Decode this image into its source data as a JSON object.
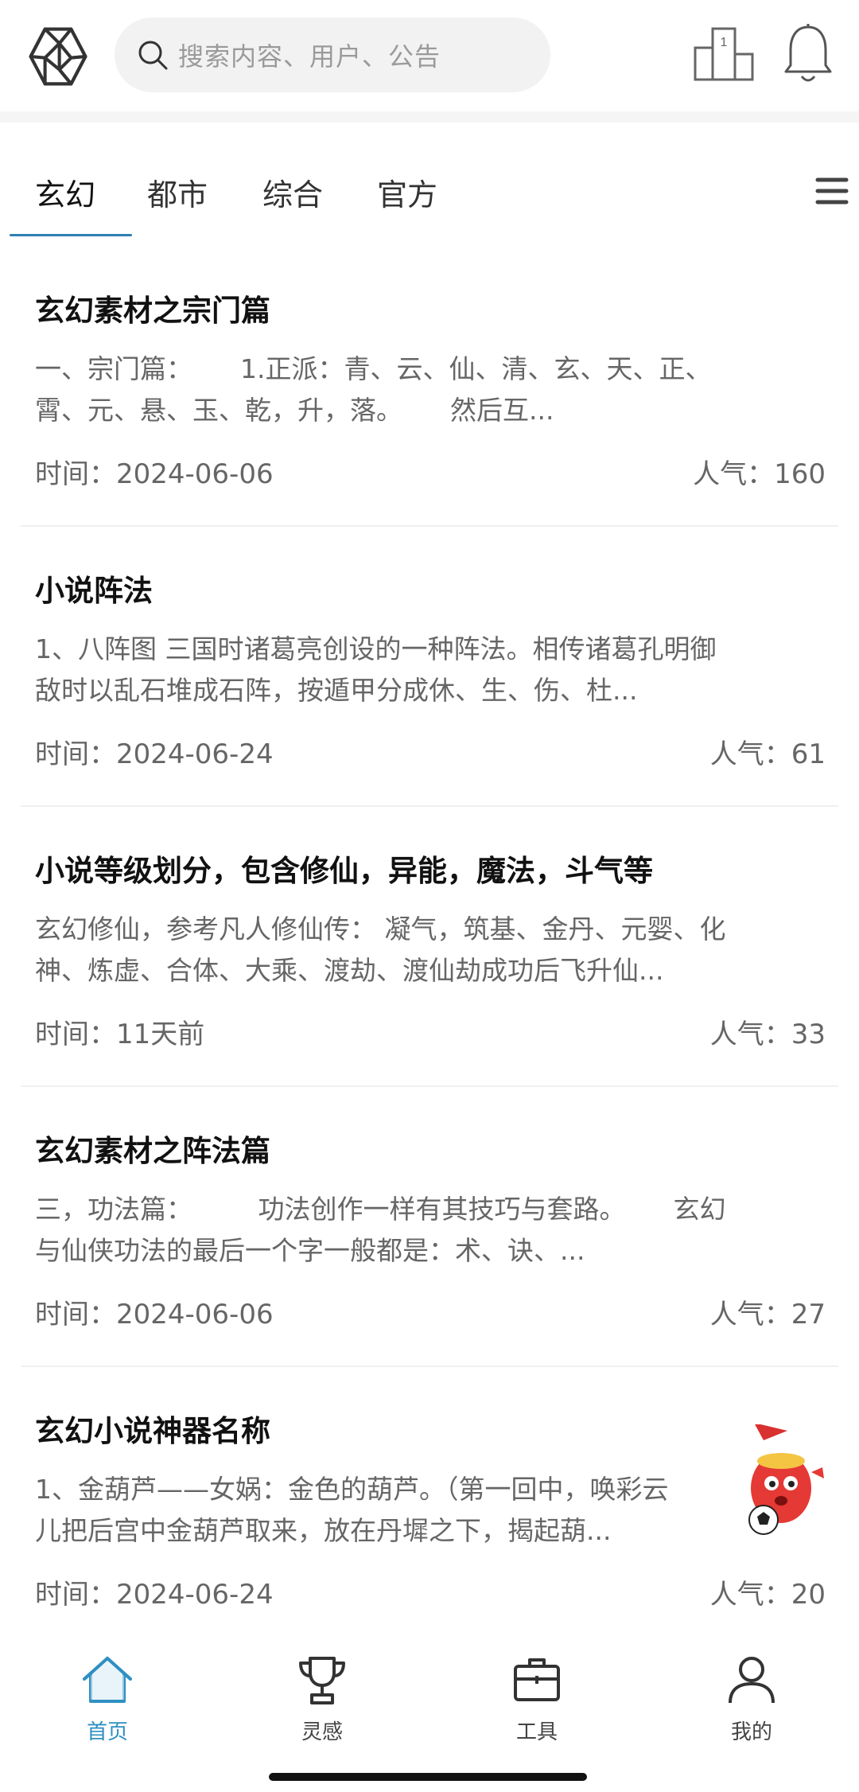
{
  "header": {
    "search_placeholder": "搜索内容、用户、公告"
  },
  "tabs": [
    {
      "label": "玄幻"
    },
    {
      "label": "都市"
    },
    {
      "label": "综合"
    },
    {
      "label": "官方"
    }
  ],
  "articles": [
    {
      "title": "玄幻素材之宗门篇",
      "excerpt": "一、宗门篇：　　 1.正派：青、云、仙、清、玄、天、正、\n霄、元、悬、玉、乾，升，落。　　 然后互...",
      "time": "时间：2024-06-06",
      "popularity": "人气：160"
    },
    {
      "title": "小说阵法",
      "excerpt": "1、八阵图 三国时诸葛亮创设的一种阵法。相传诸葛孔明御\n敌时以乱石堆成石阵，按遁甲分成休、生、伤、杜...",
      "time": "时间：2024-06-24",
      "popularity": "人气：61"
    },
    {
      "title": "小说等级划分，包含修仙，异能，魔法，斗气等",
      "excerpt": "玄幻修仙，参考凡人修仙传： 凝气，筑基、金丹、元婴、化\n神、炼虚、合体、大乘、渡劫、渡仙劫成功后飞升仙...",
      "time": "时间：11天前",
      "popularity": "人气：33"
    },
    {
      "title": "玄幻素材之阵法篇",
      "excerpt": "三，功法篇：　　　功法创作一样有其技巧与套路。　　 玄幻\n与仙侠功法的最后一个字一般都是：术、诀、...",
      "time": "时间：2024-06-06",
      "popularity": "人气：27"
    },
    {
      "title": "玄幻小说神器名称",
      "excerpt": "1、金葫芦——女娲：金色的葫芦。（第一回中，唤彩云\n儿把后宫中金葫芦取来，放在丹墀之下，揭起葫...",
      "time": "时间：2024-06-24",
      "popularity": "人气：20"
    }
  ],
  "bottom_nav": [
    {
      "label": "首页",
      "icon": "home-icon",
      "active": true
    },
    {
      "label": "灵感",
      "icon": "trophy-icon",
      "active": false
    },
    {
      "label": "工具",
      "icon": "toolbox-icon",
      "active": false
    },
    {
      "label": "我的",
      "icon": "user-icon",
      "active": false
    }
  ],
  "colors": {
    "accent": "#2f90c2",
    "underline": "#2f7fb5",
    "muted_text": "#666666"
  }
}
